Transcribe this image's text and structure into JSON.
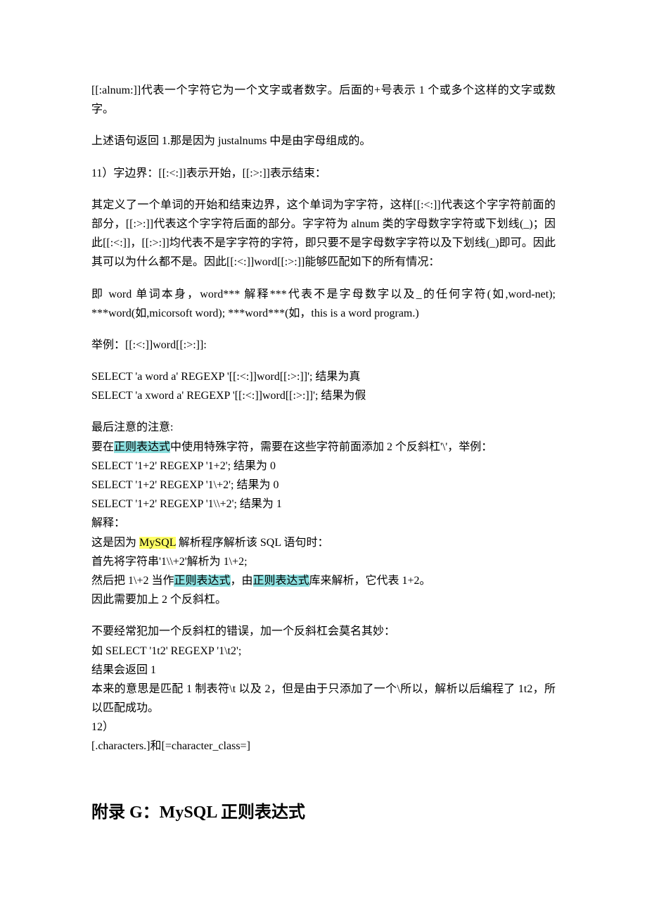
{
  "p1": "[[:alnum:]]代表一个字符它为一个文字或者数字。后面的+号表示 1 个或多个这样的文字或数字。",
  "p2": "上述语句返回 1.那是因为 justalnums 中是由字母组成的。",
  "p3": "11）字边界：[[:<:]]表示开始，[[:>:]]表示结束：",
  "p4": "其定义了一个单词的开始和结束边界，这个单词为字字符，这样[[:<:]]代表这个字字符前面的部分，[[:>:]]代表这个字字符后面的部分。字字符为 alnum 类的字母数字字符或下划线(_)；因此[[:<:]]，[[:>:]]均代表不是字字符的字符，即只要不是字母数字字符以及下划线(_)即可。因此其可以为什么都不是。因此[[:<:]]word[[:>:]]能够匹配如下的所有情况：",
  "p5": "即 word 单词本身，word*** 解释***代表不是字母数字以及_的任何字符(如,word-net); ***word(如,micorsoft word); ***word***(如，this is a word program.)",
  "p6": "举例：[[:<:]]word[[:>:]]:",
  "p7": "SELECT 'a word a' REGEXP '[[:<:]]word[[:>:]]'; 结果为真",
  "p8": "SELECT 'a xword a' REGEXP '[[:<:]]word[[:>:]]'; 结果为假",
  "p9": "最后注意的注意:",
  "p10a": "要在",
  "p10b": "正则表达式",
  "p10c": "中使用特殊字符，需要在这些字符前面添加 2 个反斜杠'\\'，举例：",
  "p11": "SELECT '1+2' REGEXP '1+2'; 结果为 0",
  "p12": "SELECT '1+2' REGEXP '1\\+2'; 结果为 0",
  "p13": "SELECT '1+2' REGEXP '1\\\\+2'; 结果为 1",
  "p14": "解释：",
  "p15a": "这是因为 ",
  "p15b": "MySQL",
  "p15c": " 解析程序解析该 SQL 语句时：",
  "p16": "首先将字符串'1\\\\+2'解析为 1\\+2;",
  "p17a": "然后把 1\\+2 当作",
  "p17b": "正则表达式",
  "p17c": "，由",
  "p17d": "正则表达式",
  "p17e": "库来解析，它代表 1+2。",
  "p18": "因此需要加上 2 个反斜杠。",
  "p19": "不要经常犯加一个反斜杠的错误，加一个反斜杠会莫名其妙：",
  "p20": "如 SELECT '1t2' REGEXP '1\\t2';",
  "p21": "结果会返回 1",
  "p22": "本来的意思是匹配 1 制表符\\t 以及 2，但是由于只添加了一个\\所以，解析以后编程了 1t2，所以匹配成功。",
  "p23": "12）",
  "p24": "[.characters.]和[=character_class=]",
  "appendix": "附录 G：MySQL 正则表达式"
}
